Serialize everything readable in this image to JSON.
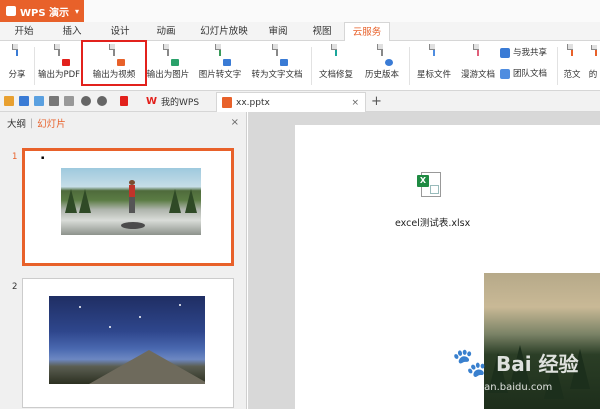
{
  "app": {
    "title": "WPS 演示",
    "chevron": "▾"
  },
  "tabs": [
    {
      "label": "开始"
    },
    {
      "label": "插入"
    },
    {
      "label": "设计"
    },
    {
      "label": "动画"
    },
    {
      "label": "幻灯片放映"
    },
    {
      "label": "审阅"
    },
    {
      "label": "视图"
    },
    {
      "label": "云服务",
      "active": true
    }
  ],
  "ribbon": {
    "share": "分享",
    "export_pdf": "输出为PDF",
    "export_video": "输出为视频",
    "export_image": "输出为图片",
    "image_to_text": "图片转文字",
    "to_text_doc": "转为文字文档",
    "doc_repair": "文档修复",
    "history": "历史版本",
    "starred": "星标文件",
    "roaming": "漫游文档",
    "shared_with_me": "与我共享",
    "team_docs": "团队文档",
    "templates": "范文",
    "more": "的"
  },
  "quickbar": {
    "wps_tab": "我的WPS",
    "doc_tab": "xx.pptx",
    "close": "×",
    "plus": "+"
  },
  "panel": {
    "outline": "大纲",
    "divider": "|",
    "slides": "幻灯片",
    "close": "×",
    "slide1_num": "1",
    "slide2_num": "2"
  },
  "canvas": {
    "attachment_name": "excel测试表.xlsx"
  },
  "watermark": {
    "brand": "Bai 经验",
    "url": "jingyan.baidu.com"
  },
  "colors": {
    "accent": "#e8612a",
    "highlight": "#e2211c",
    "excel": "#1e8a42"
  }
}
